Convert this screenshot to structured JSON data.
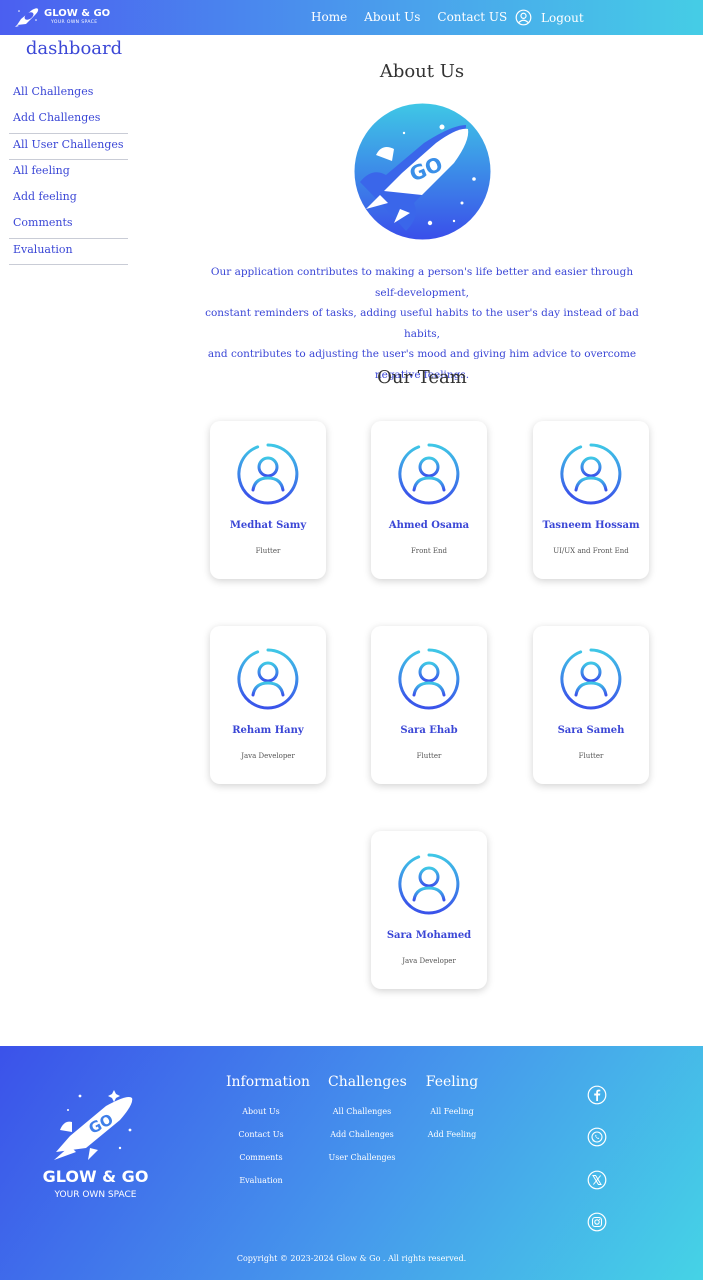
{
  "navbar": {
    "brand_name": "GLOW & GO",
    "brand_tagline": "YOUR OWN SPACE",
    "links": [
      "Home",
      "About Us",
      "Contact US"
    ],
    "logout_label": "Logout"
  },
  "sidebar": {
    "title": "dashboard",
    "items": [
      "All Challenges",
      "Add Challenges",
      "All User Challenges",
      "All feeling",
      "Add feeling",
      "Comments",
      "Evaluation"
    ]
  },
  "about": {
    "title": "About Us",
    "text_lines": [
      "Our application contributes to making a person's life better and easier through self-development,",
      "constant reminders of tasks, adding useful habits to the user's day instead of bad habits,",
      "and contributes to adjusting the user's mood and giving him advice to overcome negative feelings."
    ],
    "logo_text": "GO"
  },
  "team": {
    "title": "Our Team",
    "members": [
      {
        "name": "Medhat Samy",
        "role": "Flutter"
      },
      {
        "name": "Ahmed Osama",
        "role": "Front End"
      },
      {
        "name": "Tasneem Hossam",
        "role": "UI/UX and Front End"
      },
      {
        "name": "Reham Hany",
        "role": "Java Developer"
      },
      {
        "name": "Sara Ehab",
        "role": "Flutter"
      },
      {
        "name": "Sara Sameh",
        "role": "Flutter"
      },
      {
        "name": "Sara Mohamed",
        "role": "Java Developer"
      }
    ]
  },
  "footer": {
    "brand_name": "GLOW & GO",
    "brand_tagline": "YOUR OWN SPACE",
    "columns": [
      {
        "title": "Information",
        "links": [
          "About Us",
          "Contact Us",
          "Comments",
          "Evaluation"
        ]
      },
      {
        "title": "Challenges",
        "links": [
          "All Challenges",
          "Add Challenges",
          "User Challenges"
        ]
      },
      {
        "title": "Feeling",
        "links": [
          "All Feeling",
          "Add Feeling"
        ]
      }
    ],
    "social_icons": [
      "facebook-icon",
      "whatsapp-icon",
      "x-twitter-icon",
      "instagram-icon"
    ],
    "copyright": "Copyright © 2023-2024 Glow & Go . All rights reserved."
  },
  "colors": {
    "accent": "#3b47d6",
    "gradient_start": "#4b5ff0",
    "gradient_end": "#45cde6"
  }
}
